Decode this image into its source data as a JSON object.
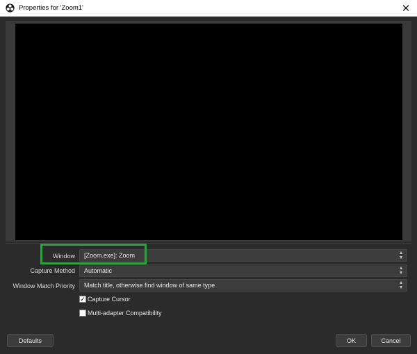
{
  "window": {
    "title": "Properties for 'Zoom1'",
    "close_glyph": "✕",
    "app_icon": "obs-icon",
    "close_icon": "close-icon"
  },
  "form": {
    "window_label": "Window",
    "window_value": "[Zoom.exe]: Zoom",
    "capture_method_label": "Capture Method",
    "capture_method_value": "Automatic",
    "match_priority_label": "Window Match Priority",
    "match_priority_value": "Match title, otherwise find window of same type",
    "capture_cursor_label": "Capture Cursor",
    "capture_cursor_checked": true,
    "multi_adapter_label": "Multi-adapter Compatibility",
    "multi_adapter_checked": false
  },
  "buttons": {
    "defaults": "Defaults",
    "ok": "OK",
    "cancel": "Cancel"
  },
  "colors": {
    "dialog_bg": "#2b2b2b",
    "preview_bg": "#000000",
    "highlight": "#2ea043"
  }
}
